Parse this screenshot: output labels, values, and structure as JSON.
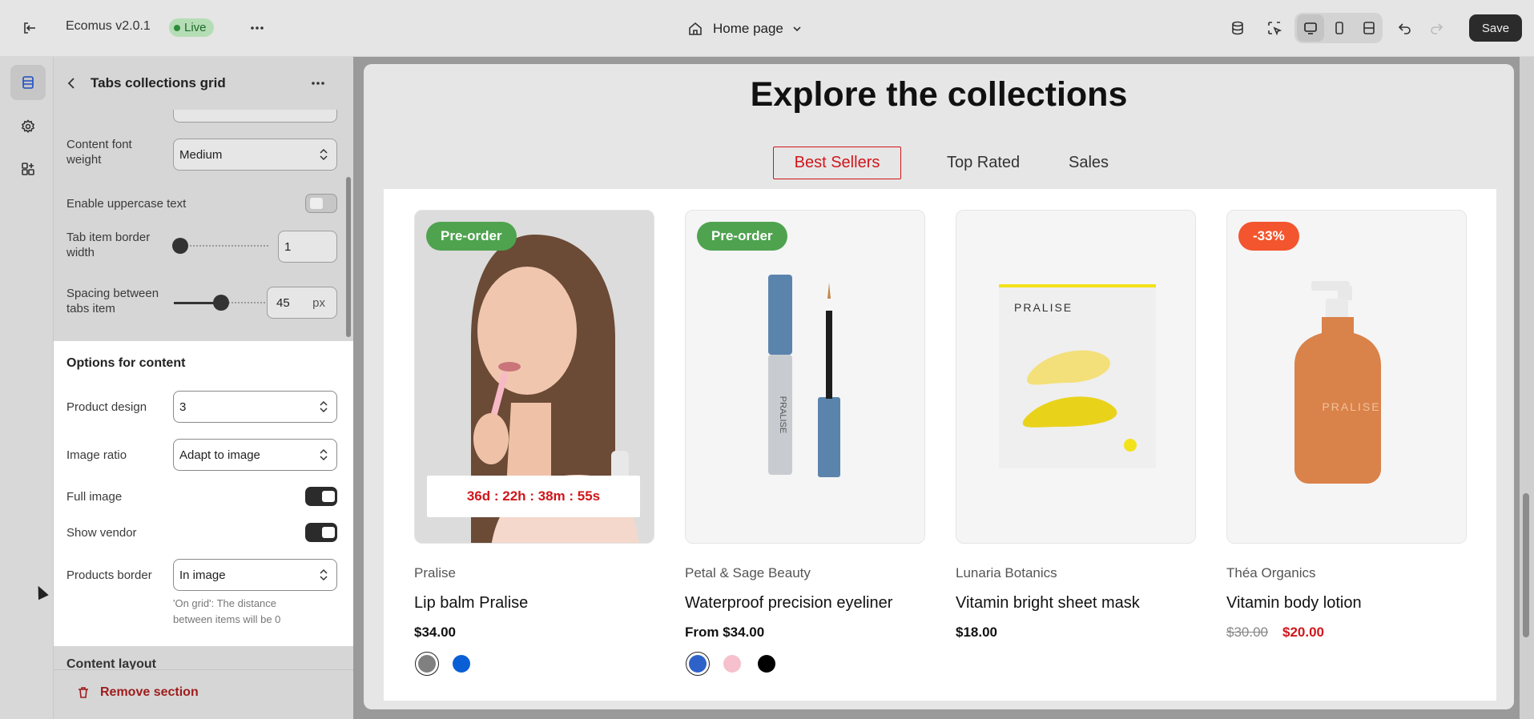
{
  "topbar": {
    "app_name": "Ecomus v2.0.1",
    "status_badge": "Live",
    "page_selector": "Home page",
    "save_label": "Save"
  },
  "panel": {
    "title": "Tabs collections grid",
    "content_font_weight_label": "Content font weight",
    "content_font_weight_value": "Medium",
    "uppercase_label": "Enable uppercase text",
    "border_width_label": "Tab item border width",
    "border_width_value": "1",
    "spacing_label": "Spacing between tabs item",
    "spacing_value": "45",
    "spacing_unit": "px",
    "options_heading": "Options for content",
    "product_design_label": "Product design",
    "product_design_value": "3",
    "image_ratio_label": "Image ratio",
    "image_ratio_value": "Adapt to image",
    "full_image_label": "Full image",
    "full_image_on": true,
    "show_vendor_label": "Show vendor",
    "show_vendor_on": true,
    "products_border_label": "Products border",
    "products_border_value": "In image",
    "products_border_help": "'On grid': The distance between items will be 0",
    "content_layout_heading": "Content layout",
    "remove_section_label": "Remove section"
  },
  "preview": {
    "heading": "Explore the collections",
    "tabs": [
      "Best Sellers",
      "Top Rated",
      "Sales"
    ],
    "active_tab": "Best Sellers",
    "products": [
      {
        "badge": "Pre-order",
        "badge_color": "#4fa34f",
        "vendor": "Pralise",
        "name": "Lip balm Pralise",
        "price": "$34.00",
        "countdown": "36d : 22h : 38m : 55s",
        "swatches": [
          "#808080",
          "#0b5fd6"
        ]
      },
      {
        "badge": "Pre-order",
        "badge_color": "#4fa34f",
        "vendor": "Petal & Sage Beauty",
        "name": "Waterproof precision eyeliner",
        "price": "From $34.00",
        "swatches": [
          "#2f62c9",
          "#f6c0cc",
          "#000000"
        ]
      },
      {
        "vendor": "Lunaria Botanics",
        "name": "Vitamin bright sheet mask",
        "price": "$18.00",
        "package_text": "PRALISE"
      },
      {
        "badge": "-33%",
        "badge_color": "#f3552e",
        "vendor": "Théa Organics",
        "name": "Vitamin body lotion",
        "old_price": "$30.00",
        "price": "$20.00",
        "bottle_text": "PRALISE"
      }
    ]
  },
  "colors": {
    "accent_red": "#d0161b",
    "sale_price": "#d0161b"
  }
}
